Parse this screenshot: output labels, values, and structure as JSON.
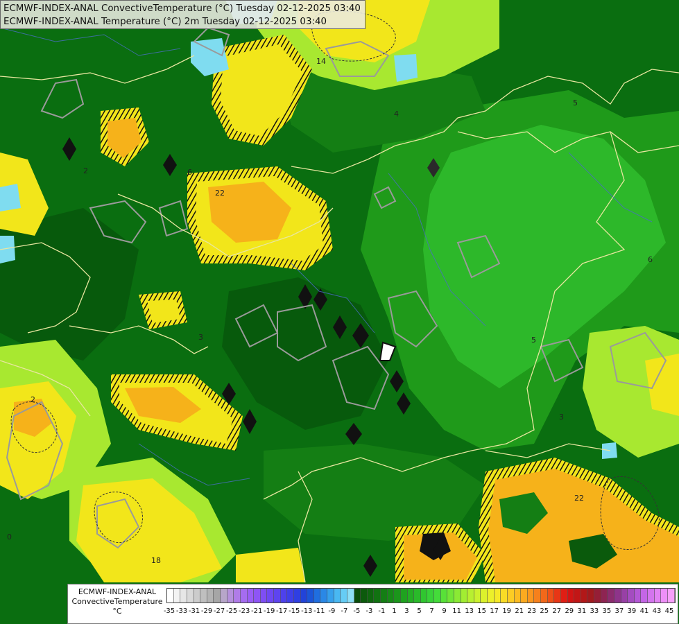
{
  "title": {
    "line1": "ECMWF-INDEX-ANAL ConvectiveTemperature (°C) Tuesday 02-12-2025 03:40",
    "line2": "ECMWF-INDEX-ANAL Temperature (°C) 2m Tuesday 02-12-2025 03:40"
  },
  "legend": {
    "line1": "ECMWF-INDEX-ANAL",
    "line2": "ConvectiveTemperature",
    "line3": "°C",
    "ticks": [
      "-35",
      "-33",
      "-31",
      "-29",
      "-27",
      "-25",
      "-23",
      "-21",
      "-19",
      "-17",
      "-15",
      "-13",
      "-11",
      "-9",
      "-7",
      "-5",
      "-3",
      "-1",
      "1",
      "3",
      "5",
      "7",
      "9",
      "11",
      "13",
      "15",
      "17",
      "19",
      "21",
      "23",
      "25",
      "27",
      "29",
      "31",
      "33",
      "35",
      "37",
      "39",
      "41",
      "43",
      "45"
    ],
    "colors": [
      "#ffffff",
      "#f3f3f3",
      "#e6e6e6",
      "#d9d9d9",
      "#cccccc",
      "#bfbfbf",
      "#b3b3b3",
      "#a6a6a6",
      "#b7a6c9",
      "#b591dc",
      "#b07ce8",
      "#a56cf0",
      "#9a5ef5",
      "#8e55f5",
      "#7f4ef4",
      "#6e48f2",
      "#5e44ef",
      "#4e41ec",
      "#3f3fe8",
      "#2f3fe2",
      "#2243d9",
      "#1b55d8",
      "#1f6ee0",
      "#2a88e6",
      "#36a0ec",
      "#49b8f2",
      "#66cdf5",
      "#8ddff7",
      "#0a4d0a",
      "#0c5a0c",
      "#0e660e",
      "#117211",
      "#147e14",
      "#178a17",
      "#1b961b",
      "#1fa21f",
      "#24ae24",
      "#2aba2a",
      "#30c630",
      "#38d238",
      "#44dc3a",
      "#58e238",
      "#70e636",
      "#8aea34",
      "#a2ee32",
      "#b8f030",
      "#ccf22e",
      "#dcf22c",
      "#ecf02a",
      "#f6ea28",
      "#fadc26",
      "#fccc24",
      "#fcbc22",
      "#fcaa20",
      "#fa961e",
      "#f6801c",
      "#f2681a",
      "#ee5018",
      "#e83616",
      "#e01e14",
      "#d21414",
      "#c21616",
      "#b21818",
      "#a21a1e",
      "#961e36",
      "#8e2452",
      "#8c2c6e",
      "#8e348a",
      "#9840a6",
      "#a44cc0",
      "#b458d6",
      "#c466e6",
      "#d474ee",
      "#e282f4",
      "#ee90f8",
      "#f6a0fa"
    ]
  },
  "map": {
    "contour_labels": [
      "14",
      "4",
      "5",
      "6",
      "22",
      "5",
      "6",
      "3",
      "2",
      "2",
      "0",
      "18",
      "22",
      "3"
    ],
    "colors": {
      "base_green": "#0a6e10",
      "mid_green": "#1f9a1a",
      "bright_green": "#2db82a",
      "lime": "#a8e830",
      "yellow": "#f2e61a",
      "orange": "#f6b21a",
      "cyan": "#7fdcf0",
      "black": "#111111",
      "border_line": "#e8e6a0",
      "contour_grey": "#9a9a9a"
    }
  }
}
